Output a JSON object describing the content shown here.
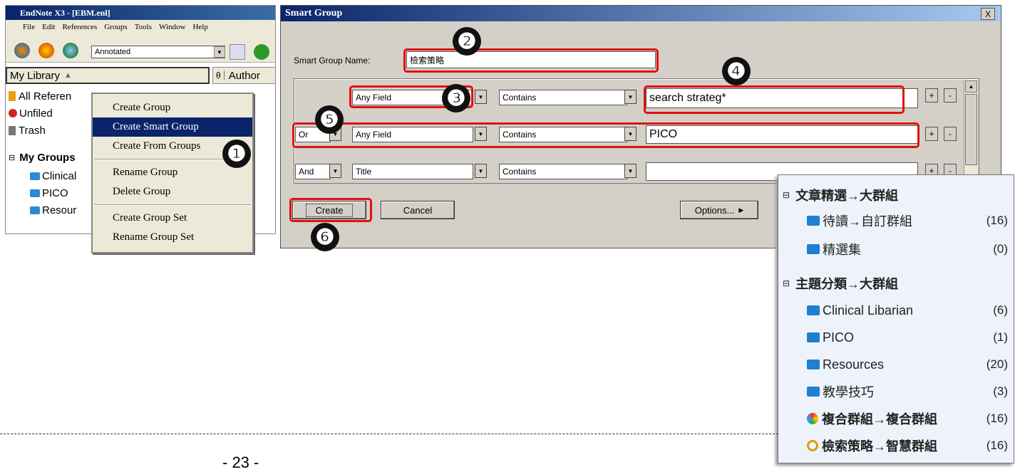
{
  "endnote": {
    "title": "EndNote X3 - [EBM.enl]",
    "menu": [
      "File",
      "Edit",
      "References",
      "Groups",
      "Tools",
      "Window",
      "Help"
    ],
    "style_combo": "Annotated",
    "library_header": "My Library",
    "author_header_icon": "θ",
    "author_header": "Author",
    "tree": {
      "all_refs": "All Referen",
      "unfiled": "Unfiled",
      "trash": "Trash",
      "my_groups": "My Groups",
      "groups": [
        "Clinical",
        "PICO",
        "Resour"
      ]
    }
  },
  "context_menu": {
    "items": [
      "Create Group",
      "Create Smart Group",
      "Create From Groups",
      "Rename Group",
      "Delete Group",
      "Create Group Set",
      "Rename Group Set"
    ]
  },
  "smart_group": {
    "title": "Smart Group",
    "close": "X",
    "name_label": "Smart Group Name:",
    "name_value": "檢索策略",
    "rows": [
      {
        "bool": "",
        "field": "Any Field",
        "op": "Contains",
        "value": "search strateg*"
      },
      {
        "bool": "Or",
        "field": "Any Field",
        "op": "Contains",
        "value": "PICO"
      },
      {
        "bool": "And",
        "field": "Title",
        "op": "Contains",
        "value": ""
      }
    ],
    "plus": "+",
    "minus": "-",
    "create_label": "Create",
    "cancel_label": "Cancel",
    "options_label": "Options..."
  },
  "badges": [
    "❶",
    "❷",
    "❸",
    "❹",
    "❺",
    "❻"
  ],
  "groups_panel": {
    "set1": "文章精選→大群組",
    "set1_items": [
      {
        "label": "待讀→自訂群組",
        "count": "(16)"
      },
      {
        "label": "精選集",
        "count": "(0)"
      }
    ],
    "set2": "主題分類→大群組",
    "set2_items": [
      {
        "label": "Clinical Libarian",
        "count": "(6)"
      },
      {
        "label": "PICO",
        "count": "(1)"
      },
      {
        "label": "Resources",
        "count": "(20)"
      },
      {
        "label": "教學技巧",
        "count": "(3)"
      },
      {
        "label": "複合群組→複合群組",
        "count": "(16)"
      },
      {
        "label": "檢索策略→智慧群組",
        "count": "(16)"
      }
    ]
  },
  "page_number": "- 23 -",
  "colors": {
    "highlight": "#e01010",
    "title_bar": "#0a246a",
    "folder": "#1f7fd1"
  }
}
